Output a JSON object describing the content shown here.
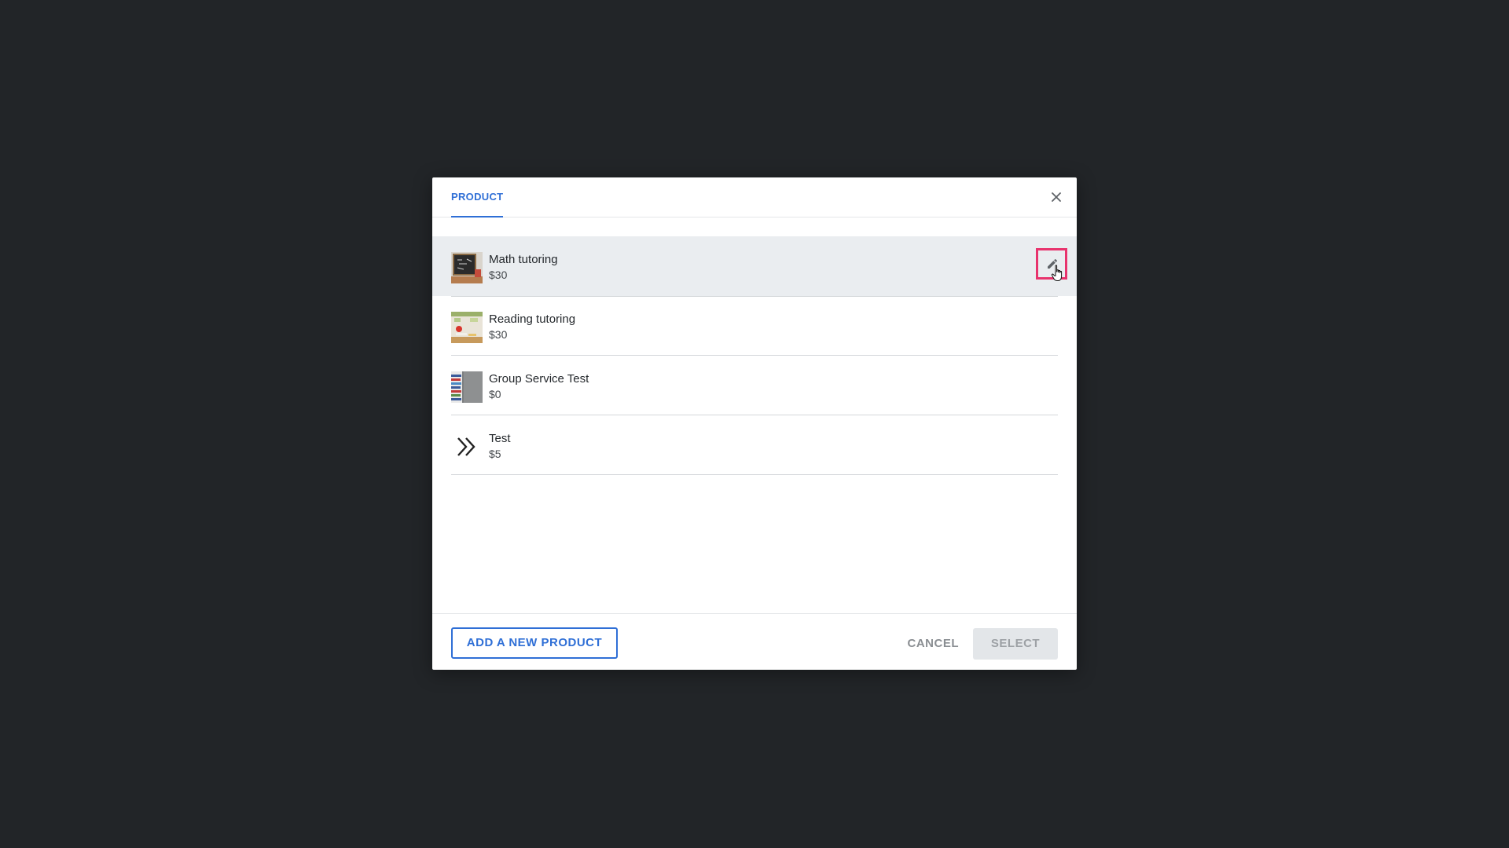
{
  "modal": {
    "tab_label": "PRODUCT",
    "close_icon": "close-icon"
  },
  "products": [
    {
      "name": "Math tutoring",
      "price": "$30",
      "thumbnail": "chalkboard-photo"
    },
    {
      "name": "Reading tutoring",
      "price": "$30",
      "thumbnail": "classroom-apple-photo"
    },
    {
      "name": "Group Service Test",
      "price": "$0",
      "thumbnail": "stacked-books-photo"
    },
    {
      "name": "Test",
      "price": "$5",
      "thumbnail": "double-chevron-right-icon"
    }
  ],
  "row_actions": {
    "edit_icon": "pencil-icon"
  },
  "footer": {
    "add_label": "ADD A NEW PRODUCT",
    "cancel_label": "CANCEL",
    "select_label": "SELECT"
  },
  "colors": {
    "accent": "#2f6fd6",
    "highlight": "#e8336d",
    "backdrop": "#222528",
    "active_row": "#eaedf0"
  }
}
